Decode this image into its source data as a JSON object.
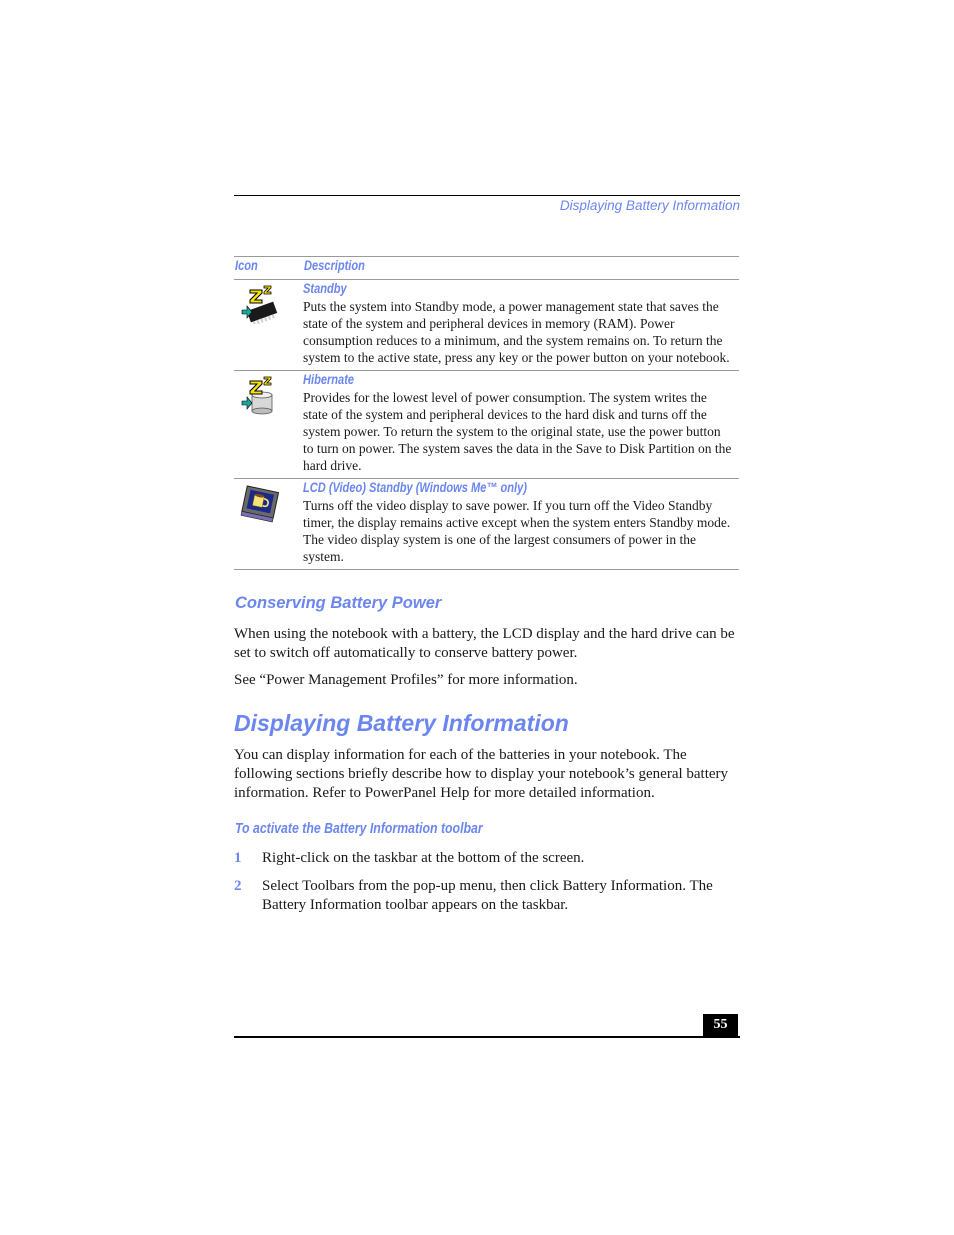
{
  "running_header": "Displaying Battery Information",
  "table": {
    "headers": {
      "icon": "Icon",
      "description": "Description"
    },
    "rows": [
      {
        "icon": "standby-icon",
        "title": "Standby",
        "body": "Puts the system into Standby mode, a power management state that saves the state of the system and peripheral devices in memory (RAM). Power consumption reduces to a minimum, and the system remains on. To return the system to the active state, press any key or the power button on your notebook."
      },
      {
        "icon": "hibernate-icon",
        "title": "Hibernate",
        "body": "Provides for the lowest level of power consumption. The system writes the state of the system and peripheral devices to the hard disk and turns off the system power. To return the system to the original state, use the power button to turn on power. The system saves the data in the Save to Disk Partition on the hard drive."
      },
      {
        "icon": "lcd-standby-icon",
        "title": "LCD (Video) Standby (Windows Me™ only)",
        "body": "Turns off the video display to save power. If you turn off the Video Standby timer, the display remains active except when the system enters Standby mode. The video display system is one of the largest consumers of power in the system."
      }
    ]
  },
  "conserving": {
    "heading": "Conserving Battery Power",
    "paragraph": "When using the notebook with a battery, the LCD display and the hard drive can be set to switch off automatically to conserve battery power.",
    "see_also": "See “Power Management Profiles”  for more information."
  },
  "displaying": {
    "heading": "Displaying Battery Information",
    "paragraph": "You can display information for each of the batteries in your notebook. The following sections briefly describe how to display your notebook’s general battery information. Refer to PowerPanel Help for more detailed information.",
    "procedure_heading": "To activate the Battery Information toolbar",
    "steps": [
      {
        "number": "1",
        "text": "Right-click on the taskbar at the bottom of the screen."
      },
      {
        "number": "2",
        "text": "Select Toolbars from the pop-up menu, then click Battery Information. The Battery Information toolbar appears on the taskbar."
      }
    ]
  },
  "page_number": "55",
  "colors": {
    "accent": "#6b86f0",
    "text": "#1a1a1a",
    "rule": "#9a9a9a"
  }
}
